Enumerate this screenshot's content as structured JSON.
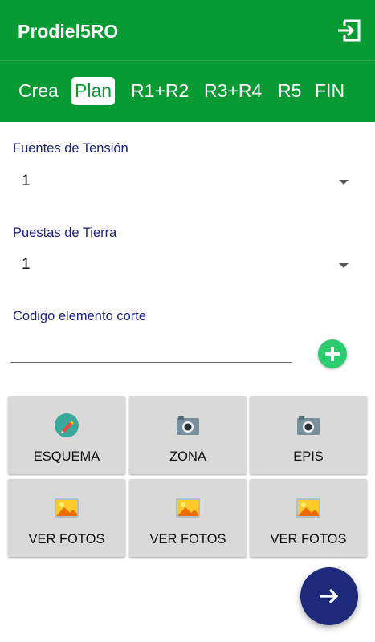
{
  "app": {
    "title": "Prodiel5RO"
  },
  "tabs": [
    {
      "label": "Crea",
      "active": false
    },
    {
      "label": "Plan",
      "active": true
    },
    {
      "label": "R1+R2",
      "active": false
    },
    {
      "label": "R3+R4",
      "active": false
    },
    {
      "label": "R5",
      "active": false
    },
    {
      "label": "FIN",
      "active": false
    }
  ],
  "form": {
    "fuentes": {
      "label": "Fuentes de Tensión",
      "value": "1"
    },
    "puestas": {
      "label": "Puestas de Tierra",
      "value": "1"
    },
    "codigo": {
      "label": "Codigo elemento corte",
      "value": "",
      "placeholder": ""
    }
  },
  "tiles": [
    {
      "label": "ESQUEMA",
      "icon": "pencil-icon"
    },
    {
      "label": "ZONA",
      "icon": "camera-icon"
    },
    {
      "label": "EPIS",
      "icon": "camera-icon"
    },
    {
      "label": "VER FOTOS",
      "icon": "image-icon"
    },
    {
      "label": "VER FOTOS",
      "icon": "image-icon"
    },
    {
      "label": "VER FOTOS",
      "icon": "image-icon"
    }
  ],
  "colors": {
    "primary": "#0a9a34",
    "label_text": "#1a237e",
    "fab": "#1d2a7a",
    "add_button": "#2ecc71",
    "tile_bg": "#d9d9d9"
  }
}
